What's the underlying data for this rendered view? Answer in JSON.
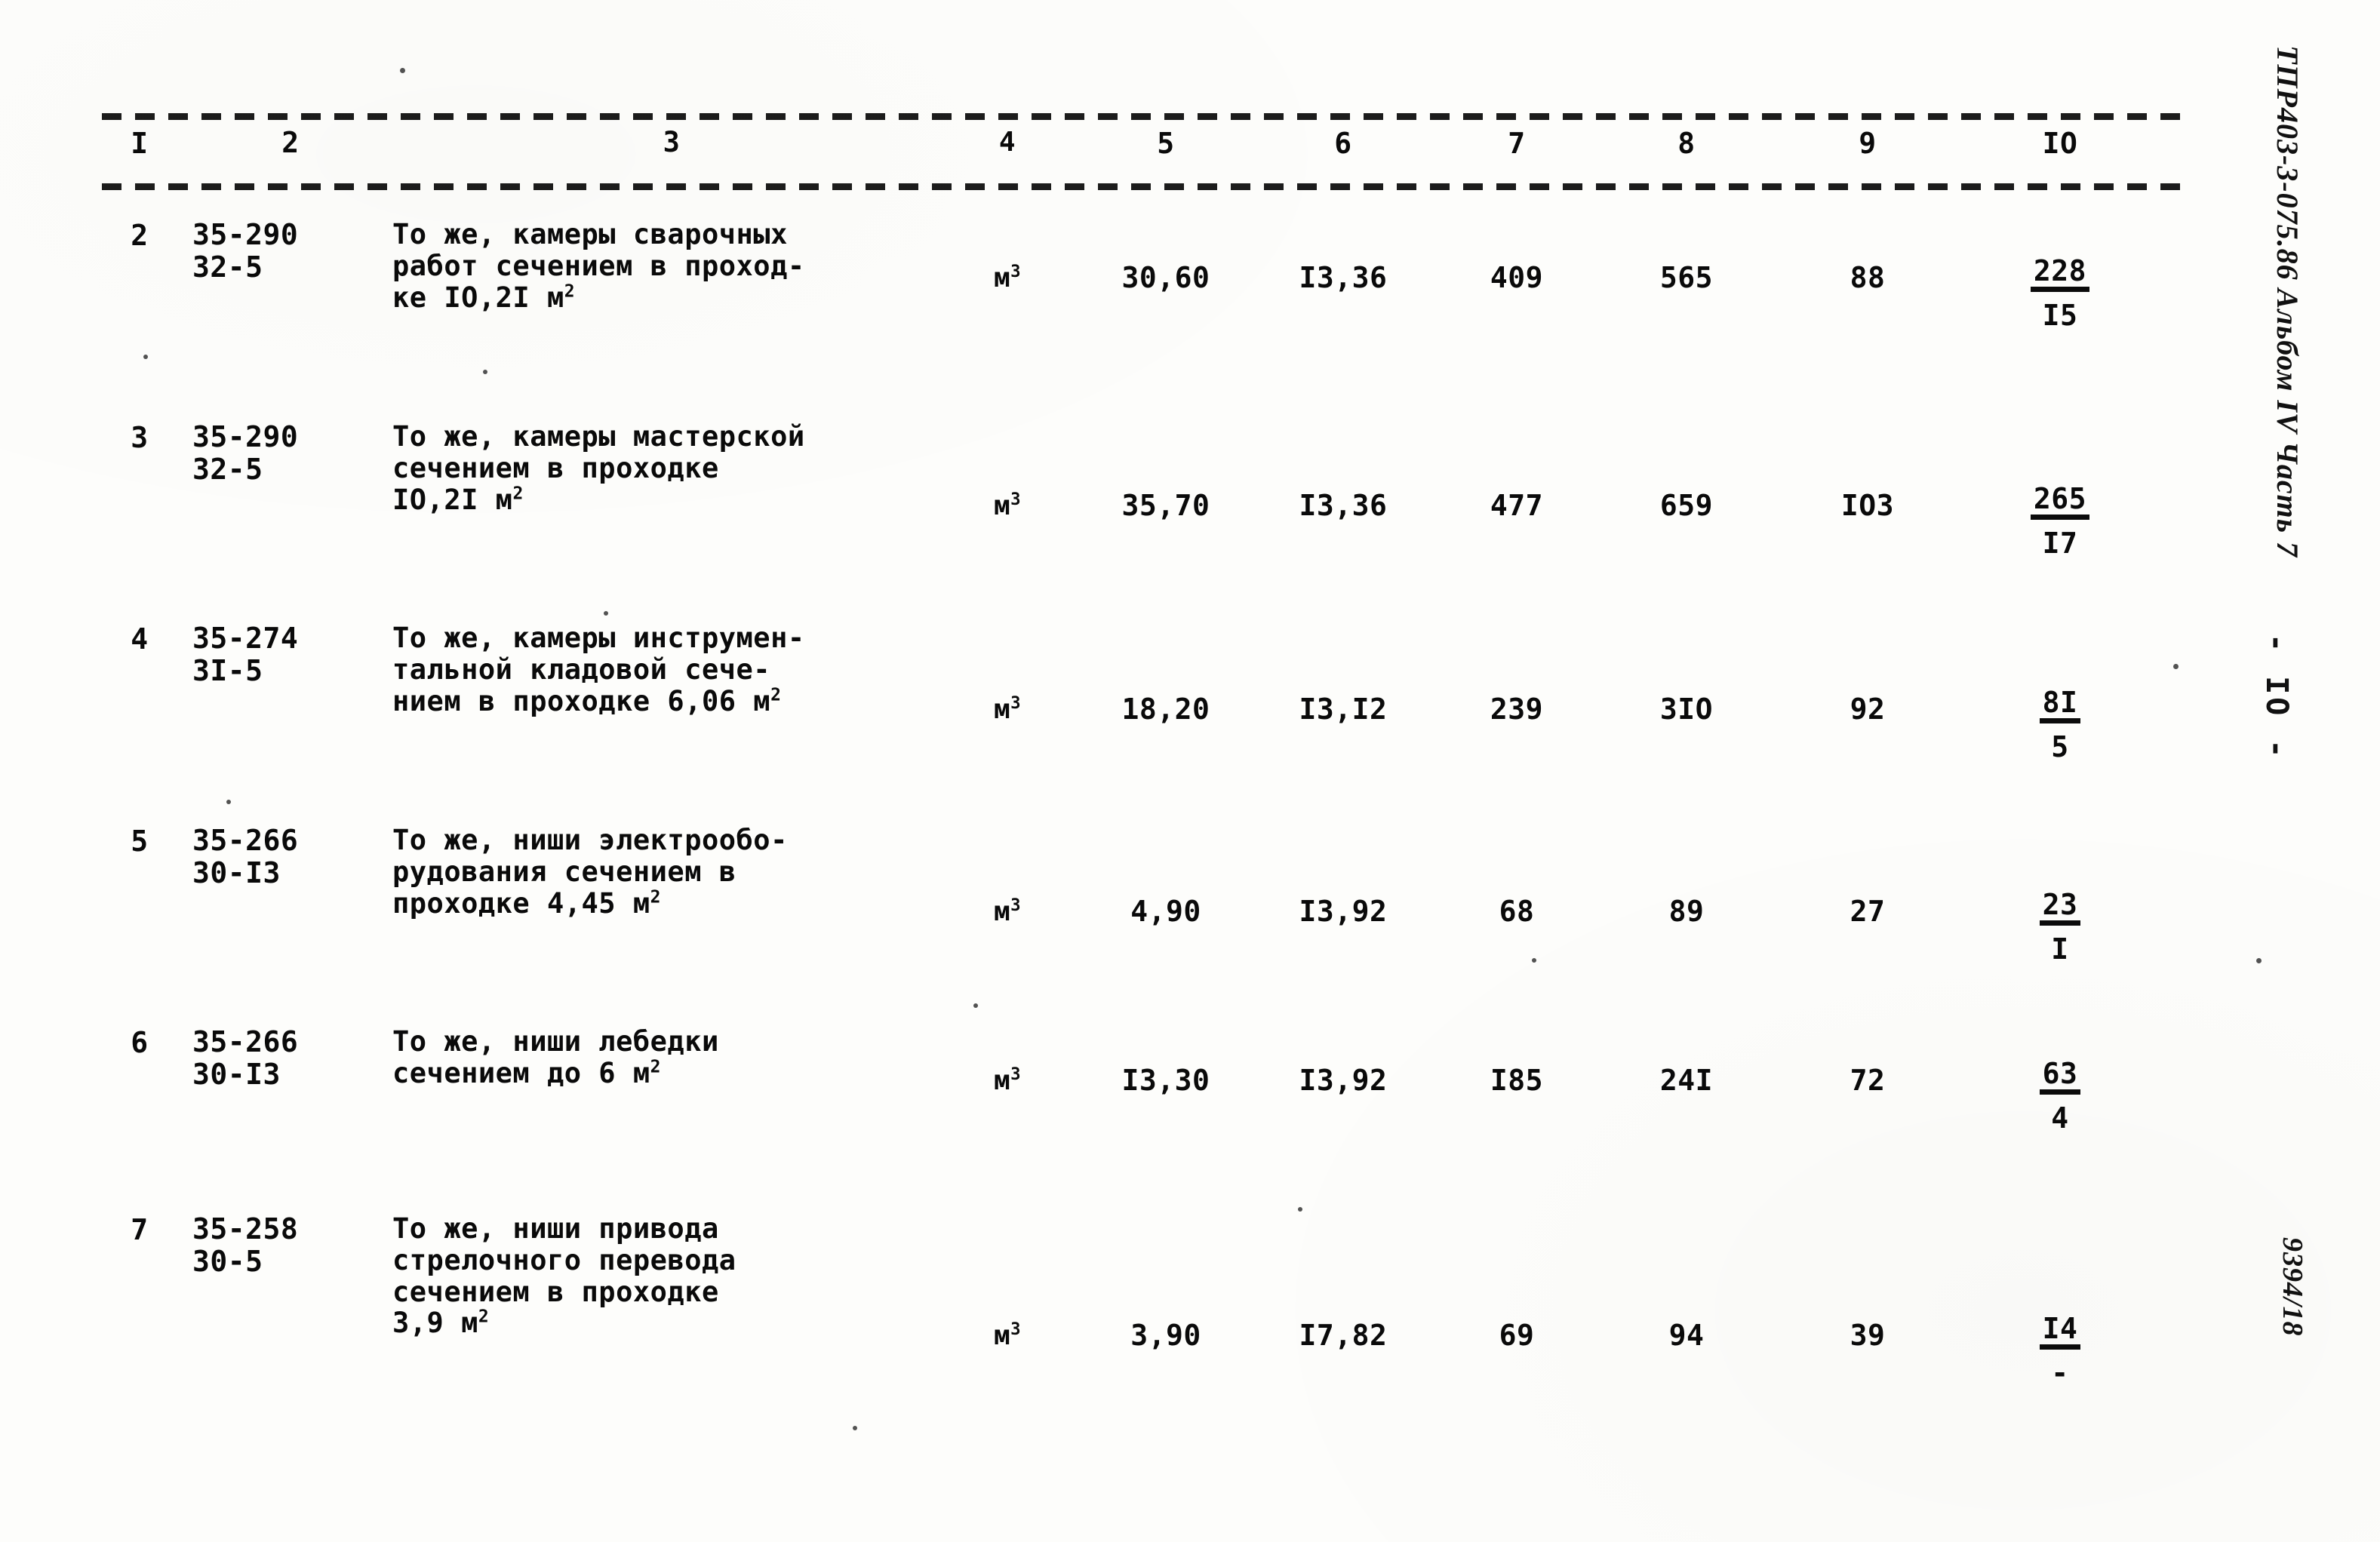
{
  "document": {
    "type": "typewritten-estimate-table",
    "margin_notes": {
      "title": "ТПР403-3-075.86 Альбом IV Часть 7",
      "page_marker": "- IO -",
      "stamp": "9394/18"
    }
  },
  "table": {
    "column_headers": [
      "I",
      "2",
      "3",
      "4",
      "5",
      "6",
      "7",
      "8",
      "9",
      "IO"
    ],
    "rows": [
      {
        "no": "2",
        "code_line1": "35-290",
        "code_line2": "32-5",
        "desc_line1": "То же, камеры сварочных",
        "desc_line2": "работ сечением в проход-",
        "desc_line3": "ке IO,2I м",
        "desc_sup": "2",
        "unit": "м",
        "unit_sup": "3",
        "c5": "30,60",
        "c6": "I3,36",
        "c7": "409",
        "c8": "565",
        "c9": "88",
        "c10_num": "228",
        "c10_den": "I5"
      },
      {
        "no": "3",
        "code_line1": "35-290",
        "code_line2": "32-5",
        "desc_line1": "То же, камеры мастерской",
        "desc_line2": "сечением в проходке",
        "desc_line3": "IO,2I м",
        "desc_sup": "2",
        "unit": "м",
        "unit_sup": "3",
        "c5": "35,70",
        "c6": "I3,36",
        "c7": "477",
        "c8": "659",
        "c9": "IO3",
        "c10_num": "265",
        "c10_den": "I7"
      },
      {
        "no": "4",
        "code_line1": "35-274",
        "code_line2": "3I-5",
        "desc_line1": "То же, камеры инструмен-",
        "desc_line2": "тальной кладовой сече-",
        "desc_line3": "нием в проходке 6,06 м",
        "desc_sup": "2",
        "unit": "м",
        "unit_sup": "3",
        "c5": "18,20",
        "c6": "I3,I2",
        "c7": "239",
        "c8": "3IO",
        "c9": "92",
        "c10_num": "8I",
        "c10_den": "5"
      },
      {
        "no": "5",
        "code_line1": "35-266",
        "code_line2": "30-I3",
        "desc_line1": "То же, ниши электрообо-",
        "desc_line2": "рудования сечением в",
        "desc_line3": "проходке 4,45 м",
        "desc_sup": "2",
        "unit": "м",
        "unit_sup": "3",
        "c5": "4,90",
        "c6": "I3,92",
        "c7": "68",
        "c8": "89",
        "c9": "27",
        "c10_num": "23",
        "c10_den": "I"
      },
      {
        "no": "6",
        "code_line1": "35-266",
        "code_line2": "30-I3",
        "desc_line1": "То же, ниши лебедки",
        "desc_line2": "сечением до 6 м",
        "desc_line3": "",
        "desc_sup": "2",
        "unit": "м",
        "unit_sup": "3",
        "c5": "I3,30",
        "c6": "I3,92",
        "c7": "I85",
        "c8": "24I",
        "c9": "72",
        "c10_num": "63",
        "c10_den": "4"
      },
      {
        "no": "7",
        "code_line1": "35-258",
        "code_line2": "30-5",
        "desc_line1": "То же, ниши привода",
        "desc_line2": "стрелочного перевода",
        "desc_line3": "сечением в проходке",
        "desc_line4": "3,9 м",
        "desc_sup": "2",
        "unit": "м",
        "unit_sup": "3",
        "c5": "3,90",
        "c6": "I7,82",
        "c7": "69",
        "c8": "94",
        "c9": "39",
        "c10_num": "I4",
        "c10_den": "-"
      }
    ]
  }
}
